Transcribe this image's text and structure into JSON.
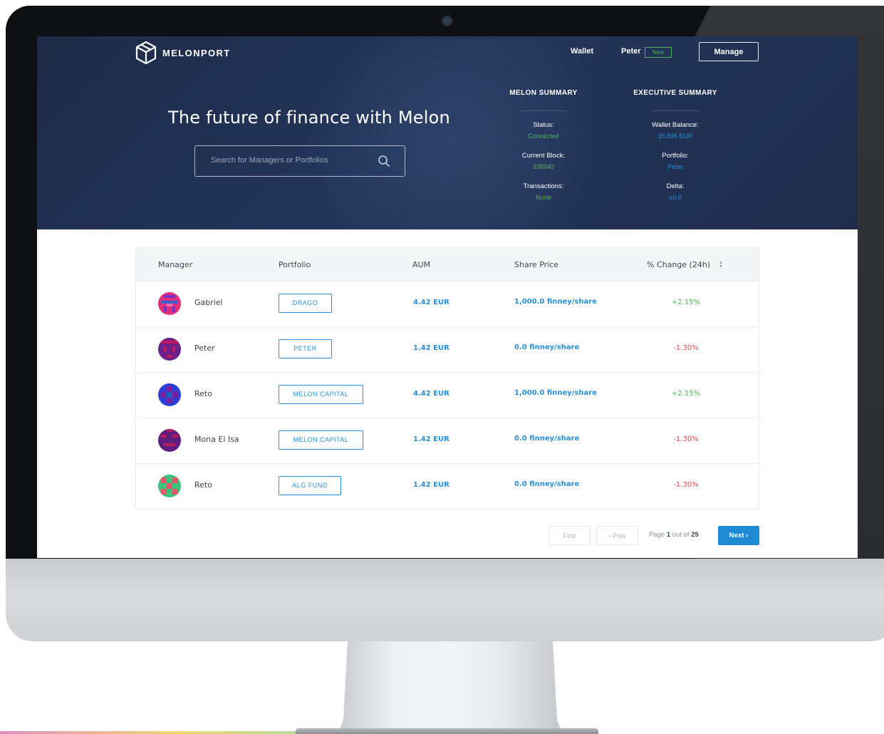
{
  "brand": {
    "name": "MELONPORT"
  },
  "nav": {
    "wallet": "Wallet",
    "user": "Peter",
    "user_badge": "New",
    "manage": "Manage"
  },
  "hero": {
    "title": "The future of finance with Melon",
    "search_placeholder": "Search for Managers or Portfolios"
  },
  "melon_summary": {
    "title": "MELON SUMMARY",
    "items": [
      {
        "label": "Status:",
        "value": "Connected"
      },
      {
        "label": "Current Block:",
        "value": "338940"
      },
      {
        "label": "Transactions:",
        "value": "None"
      }
    ]
  },
  "executive_summary": {
    "title": "EXECUTIVE SUMMARY",
    "items": [
      {
        "label": "Wallet Balance:",
        "value": "35.896 EUR"
      },
      {
        "label": "Portfolio:",
        "value": "Peter"
      },
      {
        "label": "Delta:",
        "value": "±0.0"
      }
    ]
  },
  "table": {
    "headers": [
      "Manager",
      "Portfolio",
      "AUM",
      "Share Price",
      "% Change (24h)"
    ],
    "rows": [
      {
        "manager": "Gabriel",
        "portfolio": "DRAGO",
        "aum": "4.42 EUR",
        "share_price": "1,000.0 finney/share",
        "change": "+2.15%"
      },
      {
        "manager": "Peter",
        "portfolio": "PETER",
        "aum": "1.42 EUR",
        "share_price": "0.0 finney/share",
        "change": "-1.30%"
      },
      {
        "manager": "Reto",
        "portfolio": "MELON CAPITAL",
        "aum": "4.42 EUR",
        "share_price": "1,000.0 finney/share",
        "change": "+2.15%"
      },
      {
        "manager": "Mona El Isa",
        "portfolio": "MELON CAPITAL",
        "aum": "1.42 EUR",
        "share_price": "0.0 finney/share",
        "change": "-1.30%"
      },
      {
        "manager": "Reto",
        "portfolio": "ALG FUND",
        "aum": "1.42 EUR",
        "share_price": "0.0 finney/share",
        "change": "-1.30%"
      }
    ]
  },
  "pagination": {
    "first": "First",
    "prev": "Prev",
    "page_prefix": "Page",
    "page_current": "1",
    "page_mid": "out of",
    "page_total": "25",
    "next": "Next"
  },
  "colors": {
    "accent": "#1e8ad3",
    "positive": "#4db35a",
    "negative": "#e04848",
    "hero_bg": "#22335a",
    "summary_green": "#4db35a",
    "summary_blue": "#2a8fd4"
  },
  "icons": {
    "logo": "cube-logo-icon",
    "search": "search-icon",
    "sort": "sort-arrows-icon",
    "prev": "chevron-left-icon",
    "next": "chevron-right-icon"
  }
}
